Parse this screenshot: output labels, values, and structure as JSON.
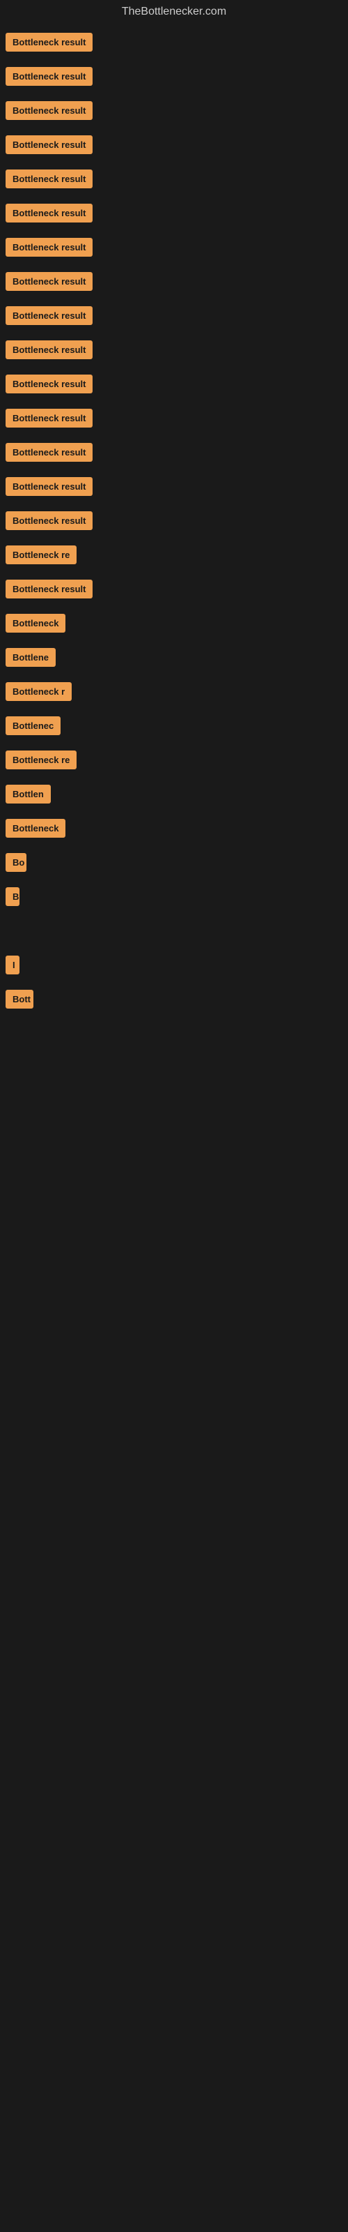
{
  "header": {
    "title": "TheBottlenecker.com"
  },
  "items": [
    {
      "label": "Bottleneck result",
      "width": 140
    },
    {
      "label": "Bottleneck result",
      "width": 140
    },
    {
      "label": "Bottleneck result",
      "width": 140
    },
    {
      "label": "Bottleneck result",
      "width": 140
    },
    {
      "label": "Bottleneck result",
      "width": 140
    },
    {
      "label": "Bottleneck result",
      "width": 140
    },
    {
      "label": "Bottleneck result",
      "width": 140
    },
    {
      "label": "Bottleneck result",
      "width": 140
    },
    {
      "label": "Bottleneck result",
      "width": 140
    },
    {
      "label": "Bottleneck result",
      "width": 140
    },
    {
      "label": "Bottleneck result",
      "width": 140
    },
    {
      "label": "Bottleneck result",
      "width": 140
    },
    {
      "label": "Bottleneck result",
      "width": 140
    },
    {
      "label": "Bottleneck result",
      "width": 140
    },
    {
      "label": "Bottleneck result",
      "width": 140
    },
    {
      "label": "Bottleneck re",
      "width": 110
    },
    {
      "label": "Bottleneck result",
      "width": 130
    },
    {
      "label": "Bottleneck",
      "width": 90
    },
    {
      "label": "Bottlene",
      "width": 75
    },
    {
      "label": "Bottleneck r",
      "width": 95
    },
    {
      "label": "Bottlenec",
      "width": 80
    },
    {
      "label": "Bottleneck re",
      "width": 105
    },
    {
      "label": "Bottlen",
      "width": 70
    },
    {
      "label": "Bottleneck",
      "width": 88
    },
    {
      "label": "Bo",
      "width": 30
    },
    {
      "label": "B",
      "width": 18
    },
    {
      "label": "",
      "width": 0
    },
    {
      "label": "I",
      "width": 10
    },
    {
      "label": "Bott",
      "width": 40
    },
    {
      "label": "",
      "width": 0
    },
    {
      "label": "",
      "width": 0
    },
    {
      "label": "",
      "width": 0
    },
    {
      "label": "",
      "width": 0
    },
    {
      "label": "",
      "width": 0
    }
  ]
}
